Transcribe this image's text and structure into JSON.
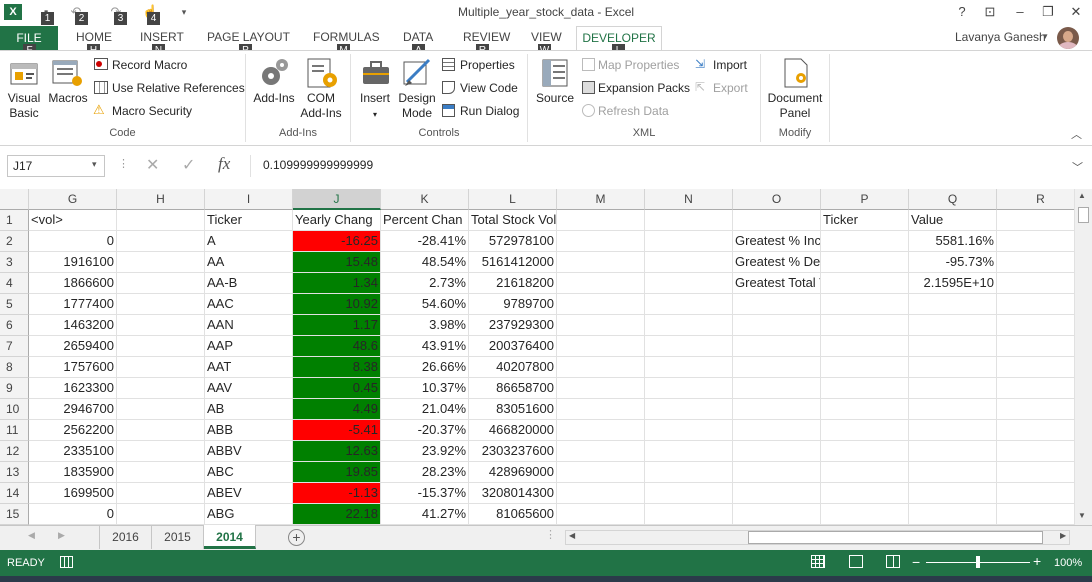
{
  "window": {
    "title": "Multiple_year_stock_data - Excel",
    "user_name": "Lavanya Ganesh",
    "help": "?",
    "qat_keytips": [
      "1",
      "2",
      "3",
      "4"
    ]
  },
  "ribbon_tabs": {
    "file": "FILE",
    "home": "HOME",
    "insert": "INSERT",
    "page_layout": "PAGE LAYOUT",
    "formulas": "FORMULAS",
    "data": "DATA",
    "review": "REVIEW",
    "view": "VIEW",
    "developer": "DEVELOPER",
    "keytips": {
      "file": "F",
      "home": "H",
      "insert": "N",
      "page_layout": "P",
      "formulas": "M",
      "data": "A",
      "review": "R",
      "view": "W",
      "developer": "L"
    }
  },
  "ribbon": {
    "code": {
      "label": "Code",
      "visual_basic": [
        "Visual",
        "Basic"
      ],
      "macros": "Macros",
      "record_macro": "Record Macro",
      "use_relative": "Use Relative References",
      "macro_security": "Macro Security"
    },
    "addins": {
      "label": "Add-Ins",
      "addins": "Add-Ins",
      "com_addins": [
        "COM",
        "Add-Ins"
      ]
    },
    "controls": {
      "label": "Controls",
      "insert": "Insert",
      "design_mode": [
        "Design",
        "Mode"
      ],
      "properties": "Properties",
      "view_code": "View Code",
      "run_dialog": "Run Dialog"
    },
    "xml": {
      "label": "XML",
      "source": "Source",
      "map_properties": "Map Properties",
      "expansion_packs": "Expansion Packs",
      "refresh_data": "Refresh Data",
      "import": "Import",
      "export": "Export"
    },
    "modify": {
      "label": "Modify",
      "document_panel": [
        "Document",
        "Panel"
      ]
    }
  },
  "formula_bar": {
    "name_box": "J17",
    "fx": "fx",
    "value": "0.109999999999999"
  },
  "columns": [
    "G",
    "H",
    "I",
    "J",
    "K",
    "L",
    "M",
    "N",
    "O",
    "P",
    "Q",
    "R"
  ],
  "rows": [
    {
      "n": "1",
      "G": "<vol>",
      "I": "Ticker",
      "J": "Yearly Chang",
      "K": "Percent Chan",
      "L": "Total Stock Volume",
      "P": "Ticker",
      "Q": "Value"
    },
    {
      "n": "2",
      "G": "0",
      "I": "A",
      "J": "-16.25",
      "K": "-28.41%",
      "L": "572978100",
      "O": "Greatest % Increase",
      "Q": "5581.16%"
    },
    {
      "n": "3",
      "G": "1916100",
      "I": "AA",
      "J": "15.48",
      "K": "48.54%",
      "L": "5161412000",
      "O": "Greatest % Decrease",
      "Q": "-95.73%"
    },
    {
      "n": "4",
      "G": "1866600",
      "I": "AA-B",
      "J": "1.34",
      "K": "2.73%",
      "L": "21618200",
      "O": "Greatest Total Volume",
      "Q": "2.1595E+10"
    },
    {
      "n": "5",
      "G": "1777400",
      "I": "AAC",
      "J": "10.92",
      "K": "54.60%",
      "L": "9789700"
    },
    {
      "n": "6",
      "G": "1463200",
      "I": "AAN",
      "J": "1.17",
      "K": "3.98%",
      "L": "237929300"
    },
    {
      "n": "7",
      "G": "2659400",
      "I": "AAP",
      "J": "48.6",
      "K": "43.91%",
      "L": "200376400"
    },
    {
      "n": "8",
      "G": "1757600",
      "I": "AAT",
      "J": "8.38",
      "K": "26.66%",
      "L": "40207800"
    },
    {
      "n": "9",
      "G": "1623300",
      "I": "AAV",
      "J": "0.45",
      "K": "10.37%",
      "L": "86658700"
    },
    {
      "n": "10",
      "G": "2946700",
      "I": "AB",
      "J": "4.49",
      "K": "21.04%",
      "L": "83051600"
    },
    {
      "n": "11",
      "G": "2562200",
      "I": "ABB",
      "J": "-5.41",
      "K": "-20.37%",
      "L": "466820000"
    },
    {
      "n": "12",
      "G": "2335100",
      "I": "ABBV",
      "J": "12.63",
      "K": "23.92%",
      "L": "2303237600"
    },
    {
      "n": "13",
      "G": "1835900",
      "I": "ABC",
      "J": "19.85",
      "K": "28.23%",
      "L": "428969000"
    },
    {
      "n": "14",
      "G": "1699500",
      "I": "ABEV",
      "J": "-1.13",
      "K": "-15.37%",
      "L": "3208014300"
    },
    {
      "n": "15",
      "G": "0",
      "I": "ABG",
      "J": "22.18",
      "K": "41.27%",
      "L": "81065600"
    }
  ],
  "sheet_tabs": [
    "2016",
    "2015",
    "2014"
  ],
  "active_sheet": "2014",
  "status": {
    "ready": "READY",
    "zoom": "100%"
  },
  "colors": {
    "excel_green": "#217346",
    "positive": "#008000",
    "negative": "#FF0000"
  }
}
